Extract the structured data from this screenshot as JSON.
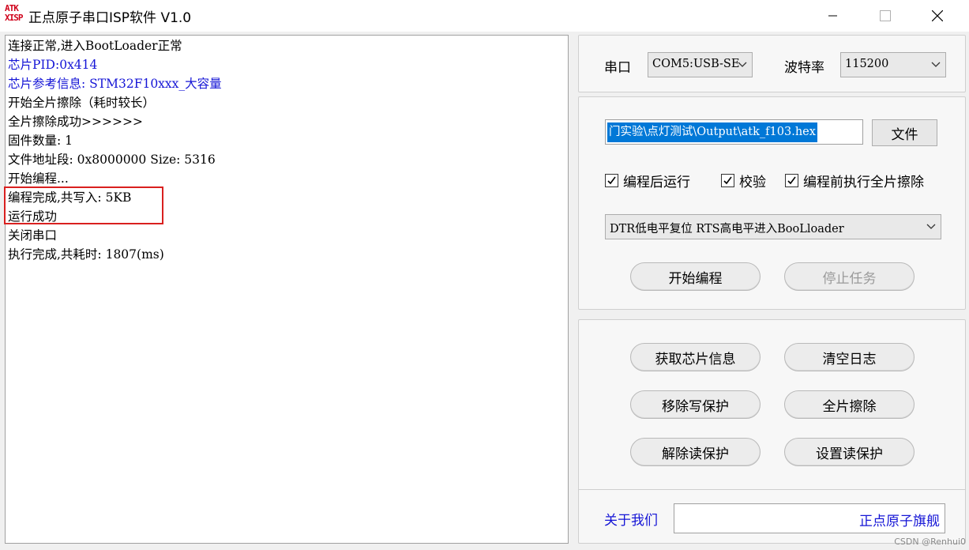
{
  "window": {
    "logo_top": "ATK",
    "logo_bottom": "XISP",
    "title": "正点原子串口ISP软件 V1.0"
  },
  "log": {
    "lines": [
      {
        "text": "连接正常,进入BootLoader正常",
        "color": "#000000"
      },
      {
        "text": "芯片PID:0x414",
        "color": "#1515d6"
      },
      {
        "text": "芯片参考信息: STM32F10xxx_大容量",
        "color": "#1515d6"
      },
      {
        "text": "开始全片擦除（耗时较长）",
        "color": "#000000"
      },
      {
        "text": "全片擦除成功>>>>>>",
        "color": "#000000"
      },
      {
        "text": "固件数量: 1",
        "color": "#000000"
      },
      {
        "text": "文件地址段: 0x8000000 Size: 5316",
        "color": "#000000"
      },
      {
        "text": "开始编程...",
        "color": "#000000"
      },
      {
        "text": "编程完成,共写入: 5KB",
        "color": "#000000"
      },
      {
        "text": "运行成功",
        "color": "#000000"
      },
      {
        "text": "关闭串口",
        "color": "#000000"
      },
      {
        "text": "执行完成,共耗时: 1807(ms)",
        "color": "#000000"
      }
    ],
    "highlight_color": "#d9201f"
  },
  "serial": {
    "port_label": "串口",
    "port_value": "COM5:USB-SE",
    "baud_label": "波特率",
    "baud_value": "115200"
  },
  "program": {
    "file_path": "门实验\\点灯测试\\Output\\atk_f103.hex",
    "file_button": "文件",
    "checks": [
      {
        "label": "编程后运行",
        "checked": true
      },
      {
        "label": "校验",
        "checked": true
      },
      {
        "label": "编程前执行全片擦除",
        "checked": true
      }
    ],
    "boot_mode": "DTR低电平复位 RTS高电平进入BooLloader",
    "start_button": "开始编程",
    "stop_button": "停止任务"
  },
  "tools": {
    "get_info": "获取芯片信息",
    "clear_log": "清空日志",
    "remove_write_protect": "移除写保护",
    "full_erase": "全片擦除",
    "remove_read_protect": "解除读保护",
    "set_read_protect": "设置读保护"
  },
  "footer": {
    "about": "关于我们",
    "brand": "正点原子旗舰",
    "watermark": "CSDN @Renhui0"
  },
  "colors": {
    "accent_blue": "#1515d6",
    "selection": "#0078d7"
  }
}
